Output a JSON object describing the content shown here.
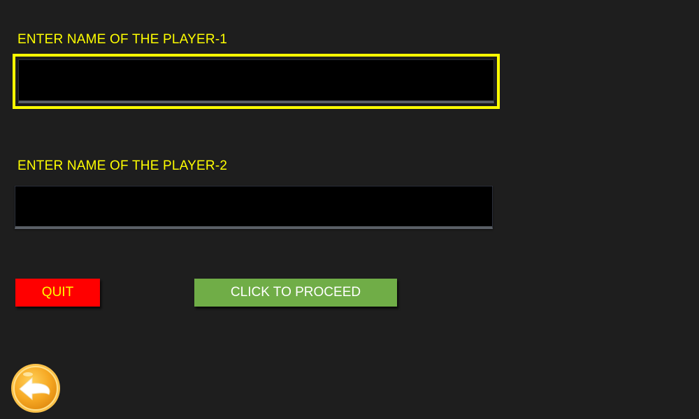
{
  "player1": {
    "label": "ENTER NAME OF THE PLAYER-1",
    "value": "",
    "focused": true
  },
  "player2": {
    "label": "ENTER NAME OF THE PLAYER-2",
    "value": ""
  },
  "buttons": {
    "quit_label": "QUIT",
    "proceed_label": "CLICK TO PROCEED"
  },
  "back_button": {
    "icon": "back-arrow-icon"
  },
  "colors": {
    "background": "#1e1e1e",
    "label_text": "#ffff00",
    "focus_border": "#ffff00",
    "input_bg": "#000000",
    "quit_bg": "#ff0000",
    "quit_text": "#ffff00",
    "proceed_bg": "#70ad47",
    "proceed_text": "#ffffff",
    "back_button_bg": "#f6a823"
  }
}
